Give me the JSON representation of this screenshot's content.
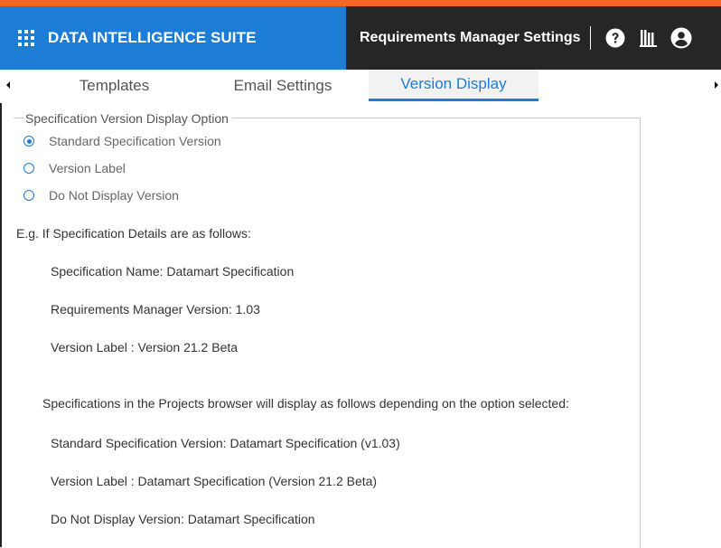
{
  "header": {
    "app_name": "DATA INTELLIGENCE SUITE",
    "settings_title": "Requirements Manager Settings",
    "icons": [
      "grid-menu-icon",
      "help-icon",
      "library-icon",
      "user-icon"
    ],
    "colors": {
      "brand": "#1c7cd6",
      "dark": "#262626",
      "accent": "#f26722"
    }
  },
  "tabs": [
    {
      "label": "Templates",
      "active": false
    },
    {
      "label": "Email Settings",
      "active": false
    },
    {
      "label": "Version Display",
      "active": true
    }
  ],
  "version_display": {
    "legend": "Specification Version Display Option",
    "options": [
      {
        "label": "Standard Specification Version",
        "selected": true
      },
      {
        "label": "Version Label",
        "selected": false
      },
      {
        "label": "Do Not Display Version",
        "selected": false
      }
    ],
    "example_intro": "E.g. If Specification Details are as follows:",
    "details": [
      "Specification Name: Datamart Specification",
      "Requirements Manager Version: 1.03",
      "Version Label : Version 21.2 Beta"
    ],
    "display_intro": "Specifications in the Projects browser will display as follows depending on the option selected:",
    "display_examples": [
      "Standard Specification Version: Datamart Specification (v1.03)",
      "Version Label : Datamart Specification (Version 21.2 Beta)",
      "Do Not Display Version: Datamart Specification"
    ]
  }
}
